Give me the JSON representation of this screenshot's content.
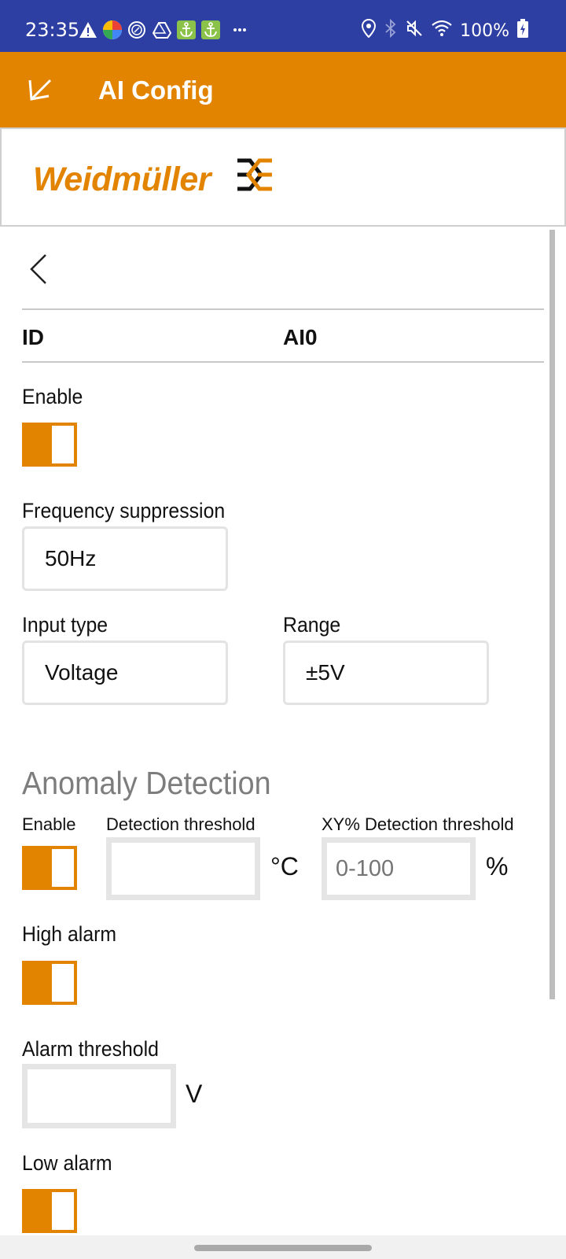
{
  "status_bar": {
    "time": "23:35",
    "notification_icons": [
      "alert-triangle-icon",
      "google-photos-icon",
      "percent-circle-icon",
      "drive-icon",
      "anchor-icon",
      "anchor-icon",
      "more-dots-icon"
    ],
    "status_icons": [
      "location-icon",
      "bluetooth-icon",
      "muted-icon",
      "wifi-icon",
      "battery-charging-icon"
    ],
    "battery": "100%",
    "bar_color": "#2e3fa3"
  },
  "app_bar": {
    "title": "AI Config",
    "color": "#e38400"
  },
  "logo": {
    "text": "Weidmüller",
    "brand_color": "#e38400"
  },
  "id_row": {
    "label": "ID",
    "value": "AI0"
  },
  "enable": {
    "label": "Enable",
    "on": true
  },
  "frequency_suppression": {
    "label": "Frequency suppression",
    "value": "50Hz"
  },
  "input_type": {
    "label": "Input type",
    "value": "Voltage"
  },
  "range": {
    "label": "Range",
    "value": "±5V"
  },
  "anomaly_detection": {
    "title": "Anomaly Detection",
    "enable_label": "Enable",
    "enable_on": true,
    "detection_threshold_label": "Detection threshold",
    "detection_threshold_value": "",
    "detection_threshold_unit": "°C",
    "xy_threshold_label": "XY% Detection threshold",
    "xy_threshold_placeholder": "0-100",
    "xy_threshold_unit": "%"
  },
  "high_alarm": {
    "label": "High alarm",
    "on": true
  },
  "alarm_threshold": {
    "label": "Alarm threshold",
    "value": "",
    "unit": "V"
  },
  "low_alarm": {
    "label": "Low alarm",
    "on": true
  }
}
